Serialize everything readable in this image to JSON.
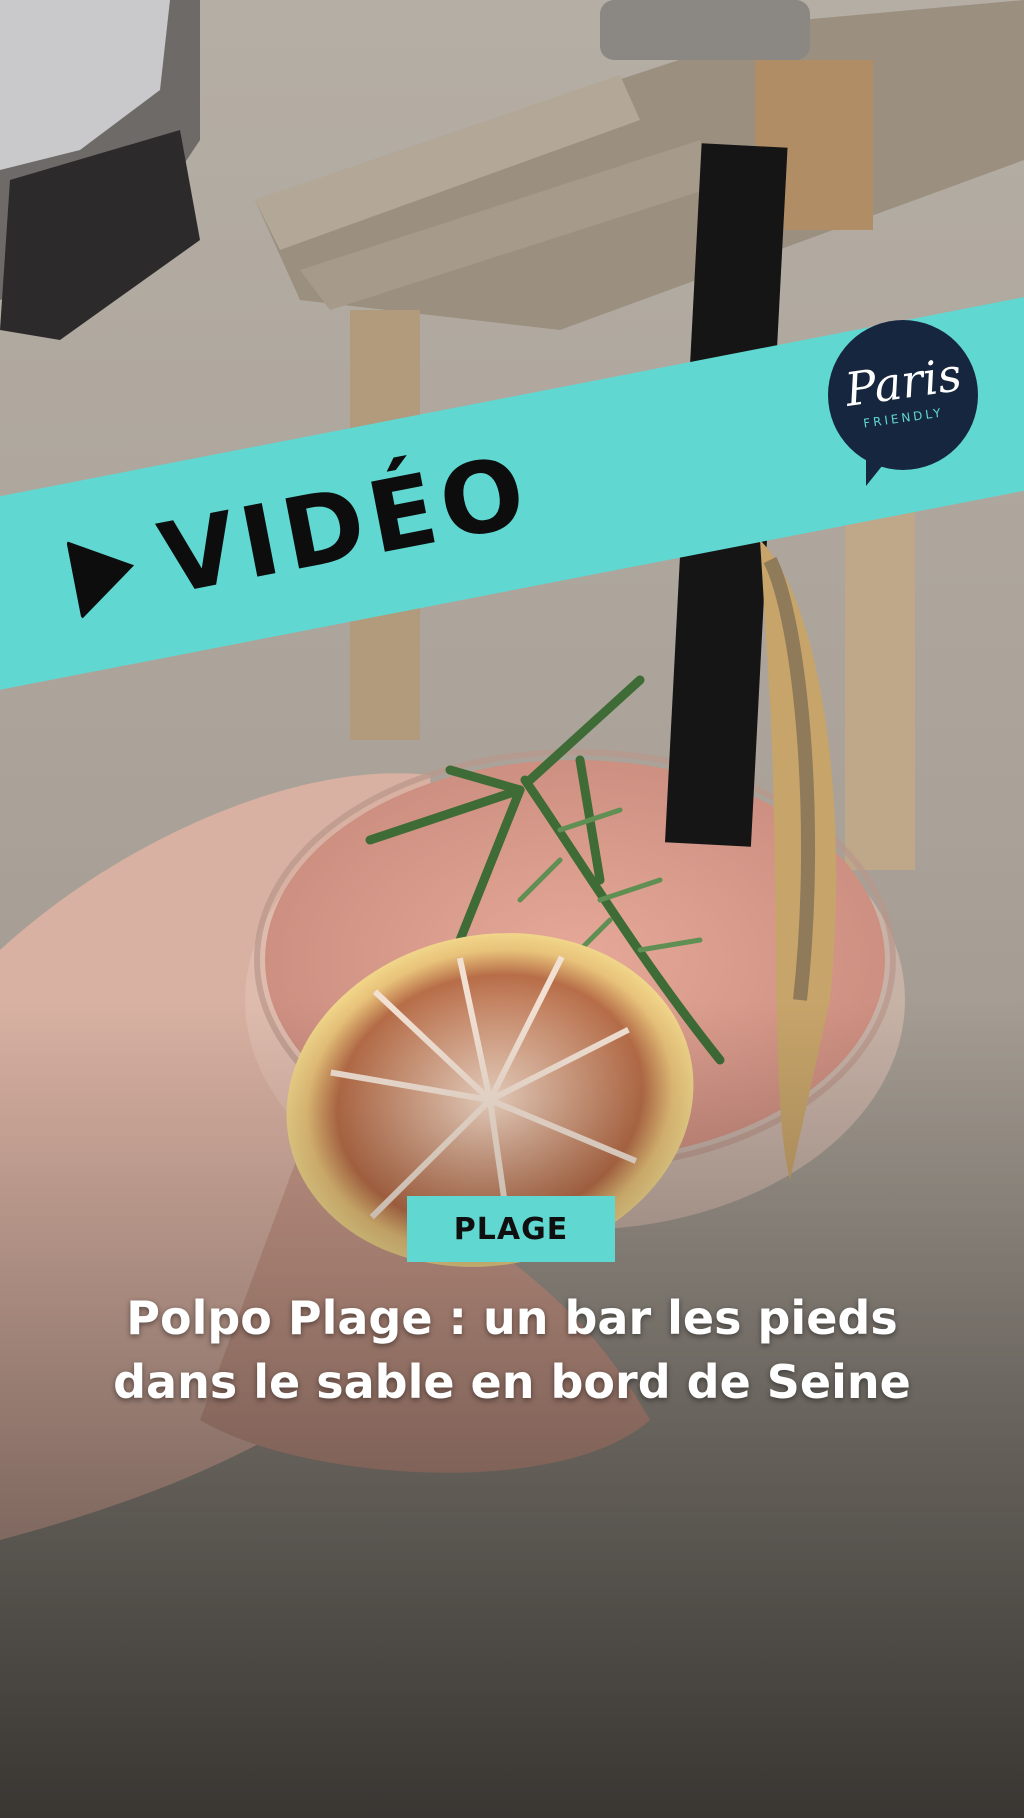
{
  "banner": {
    "label": "VIDÉO",
    "icon": "play-icon",
    "color": "#60d8d1"
  },
  "logo": {
    "main": "Paris",
    "sub": "FRIENDLY",
    "background": "#15263e"
  },
  "category": {
    "label": "PLAGE",
    "color": "#60d8d1"
  },
  "article": {
    "title_line1": "Polpo Plage : un bar les pieds",
    "title_line2": "dans le sable en bord de Seine"
  }
}
